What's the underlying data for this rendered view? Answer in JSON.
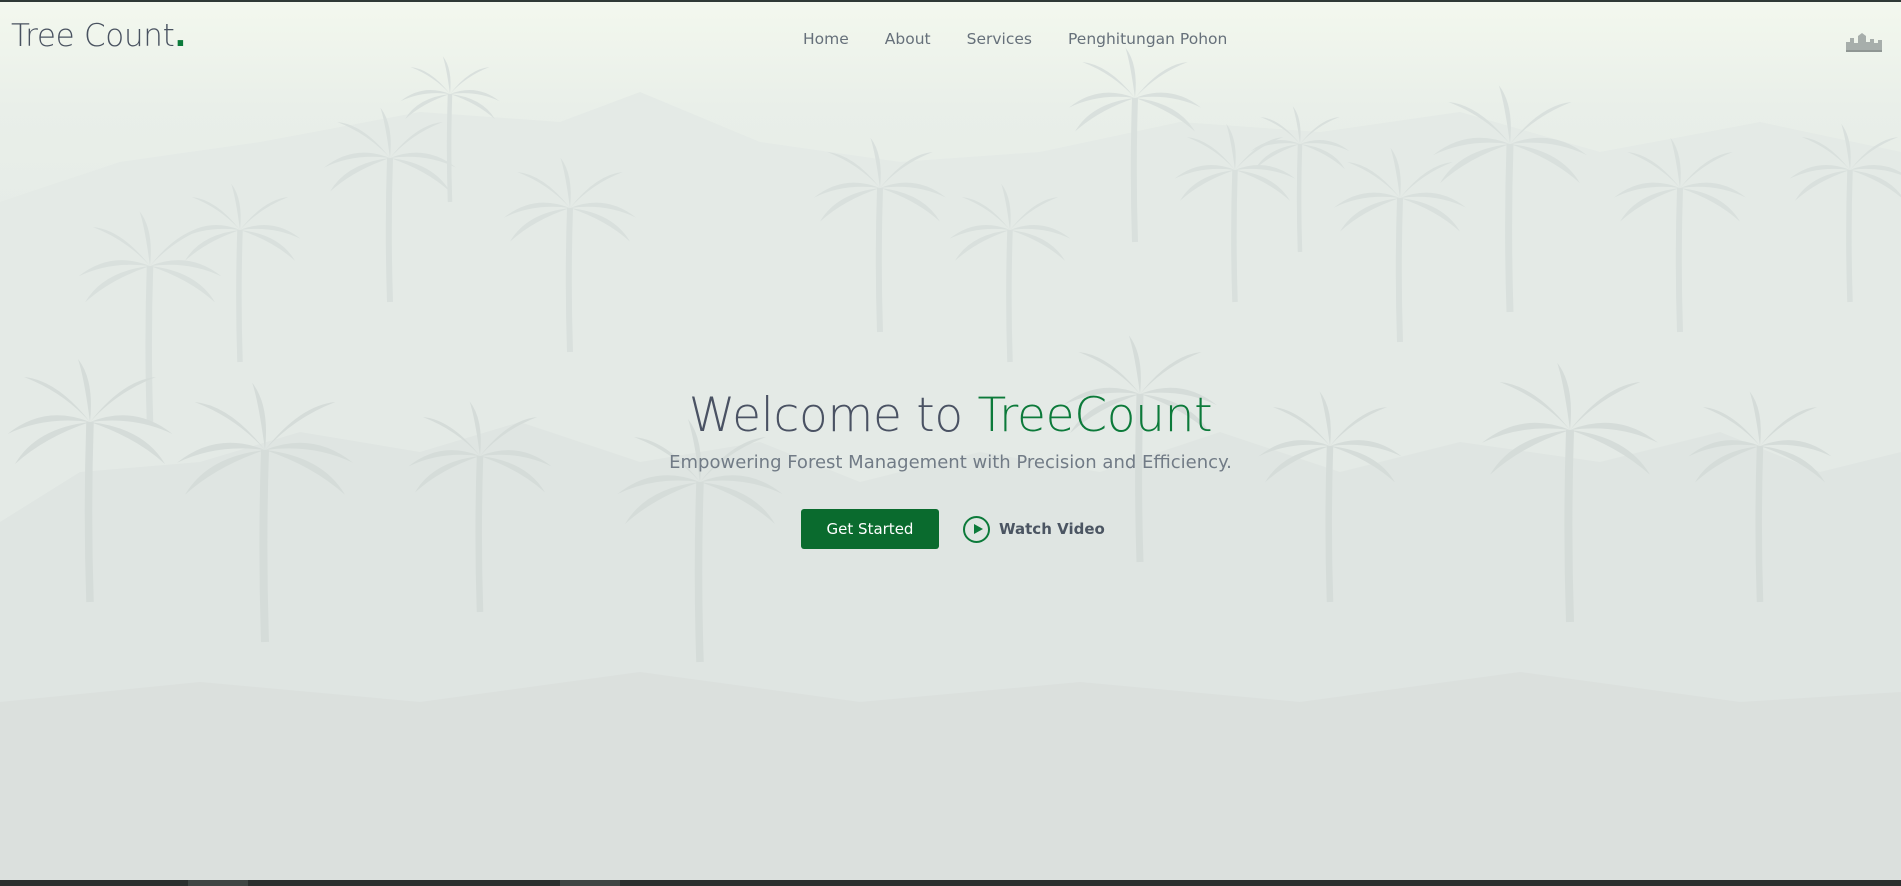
{
  "header": {
    "logo_text": "Tree Count",
    "logo_dot": ".",
    "nav": [
      "Home",
      "About",
      "Services",
      "Penghitungan Pohon"
    ]
  },
  "hero": {
    "title_prefix": "Welcome to ",
    "title_accent": "TreeCount",
    "subtitle": "Empowering Forest Management with Precision and Efficiency.",
    "primary_button": "Get Started",
    "video_button": "Watch Video"
  },
  "colors": {
    "accent": "#0c7a3a",
    "button_bg": "#0a6b2e",
    "heading": "#4a5263",
    "text_muted": "#717b86"
  },
  "icons": {
    "video": "play-circle-icon",
    "header_right": "skyline-logo-icon"
  }
}
